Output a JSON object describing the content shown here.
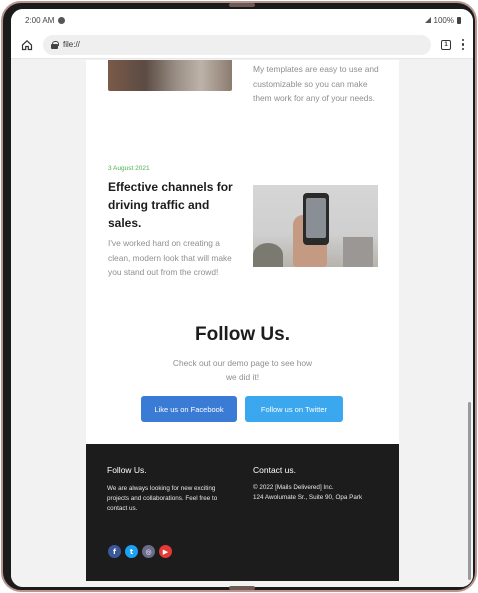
{
  "status_bar": {
    "time": "2:00 AM",
    "battery": "100%"
  },
  "browser": {
    "url": "file://",
    "tab_count": "1"
  },
  "top_section": {
    "text": "My templates are easy to use and customizable so you can make them work for any of your needs."
  },
  "article": {
    "date": "3 August 2021",
    "title": "Effective channels for driving traffic and sales.",
    "body": "I've worked hard on creating a clean, modern look that will make you stand out from the crowd!"
  },
  "follow": {
    "title": "Follow Us.",
    "subtitle": "Check out our demo page to see how we did it!",
    "facebook_button": "Like us on Facebook",
    "twitter_button": "Follow us on Twitter"
  },
  "footer": {
    "left_title": "Follow Us.",
    "left_text": "We are always looking for new exciting projects and collaborations. Feel free to contact us.",
    "right_title": "Contact us.",
    "copyright": "© 2022 [Mails Delivered] Inc.",
    "address": "124 Awolumate Sr., Suite 90, Opa Park",
    "social_icons": [
      "facebook-icon",
      "twitter-icon",
      "instagram-icon",
      "youtube-icon"
    ]
  },
  "colors": {
    "date_green": "#4caf50",
    "facebook_blue": "#3a7bd5",
    "twitter_blue": "#3ba7ee",
    "footer_bg": "#1c1c1c"
  }
}
